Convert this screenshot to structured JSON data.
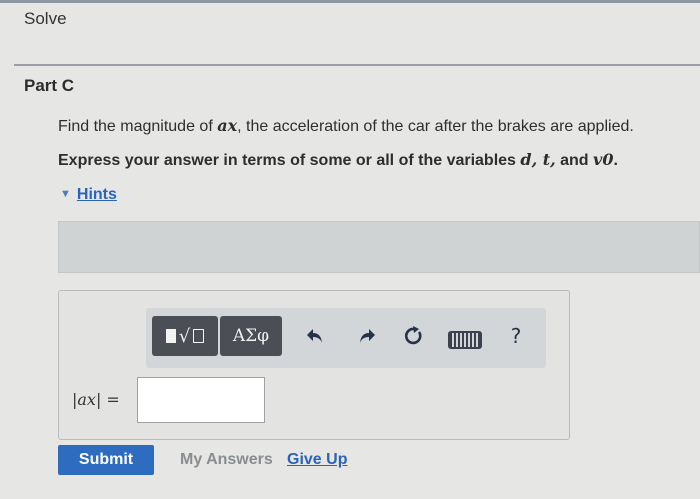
{
  "header": {
    "solve": "Solve"
  },
  "part": {
    "title": "Part C"
  },
  "question": {
    "line1_prefix": "Find the magnitude of ",
    "line1_var": "ax",
    "line1_suffix": ", the acceleration of the car after the brakes are applied.",
    "line2_prefix": "Express your answer in terms of some or all of the variables ",
    "line2_vars": "d, t,",
    "line2_and": " and ",
    "line2_v0": "v0",
    "line2_end": "."
  },
  "hints": {
    "label": "Hints"
  },
  "toolbar": {
    "greek_label": "ΑΣφ",
    "help_label": "?",
    "icons": [
      "templates-icon",
      "greek-icon",
      "undo-icon",
      "redo-icon",
      "reset-icon",
      "keyboard-icon",
      "help-icon"
    ]
  },
  "answer": {
    "label": "|ax| =",
    "value": ""
  },
  "actions": {
    "submit": "Submit",
    "my_answers": "My Answers",
    "give_up": "Give Up"
  },
  "colors": {
    "accent": "#2e6cbf",
    "link": "#2b63b8",
    "toolbar_button": "#4b4f55"
  }
}
